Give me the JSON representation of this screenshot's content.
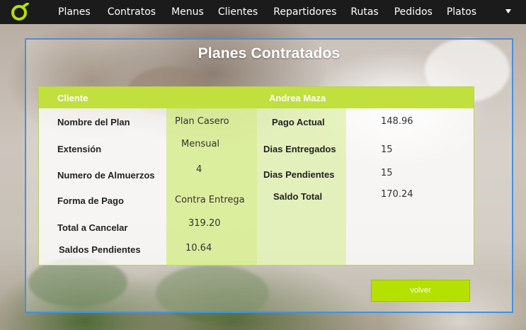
{
  "nav": {
    "items": [
      "Planes",
      "Contratos",
      "Menus",
      "Clientes",
      "Repartidores",
      "Rutas",
      "Pedidos",
      "Platos"
    ]
  },
  "panel": {
    "title": "Planes Contratados"
  },
  "table": {
    "header": {
      "left": "Cliente",
      "right": "Andrea Maza"
    },
    "left_labels": [
      "Nombre del Plan",
      "Extensión",
      "Numero de Almuerzos",
      "Forma de Pago",
      "Total a Cancelar",
      "Saldos Pendientes"
    ],
    "left_values": [
      "Plan Casero",
      "Mensual",
      "4",
      "Contra Entrega",
      "319.20",
      "10.64"
    ],
    "right_labels": [
      "Pago Actual",
      "Dias Entregados",
      "Dias Pendientes",
      "Saldo Total"
    ],
    "right_values": [
      "148.96",
      "15",
      "15",
      "170.24"
    ]
  },
  "actions": {
    "back_label": "volver"
  },
  "colors": {
    "accent": "#c1e03e",
    "button": "#b6e000",
    "nav_bg": "#1b1b1b",
    "panel_border": "#4a8fd6"
  }
}
